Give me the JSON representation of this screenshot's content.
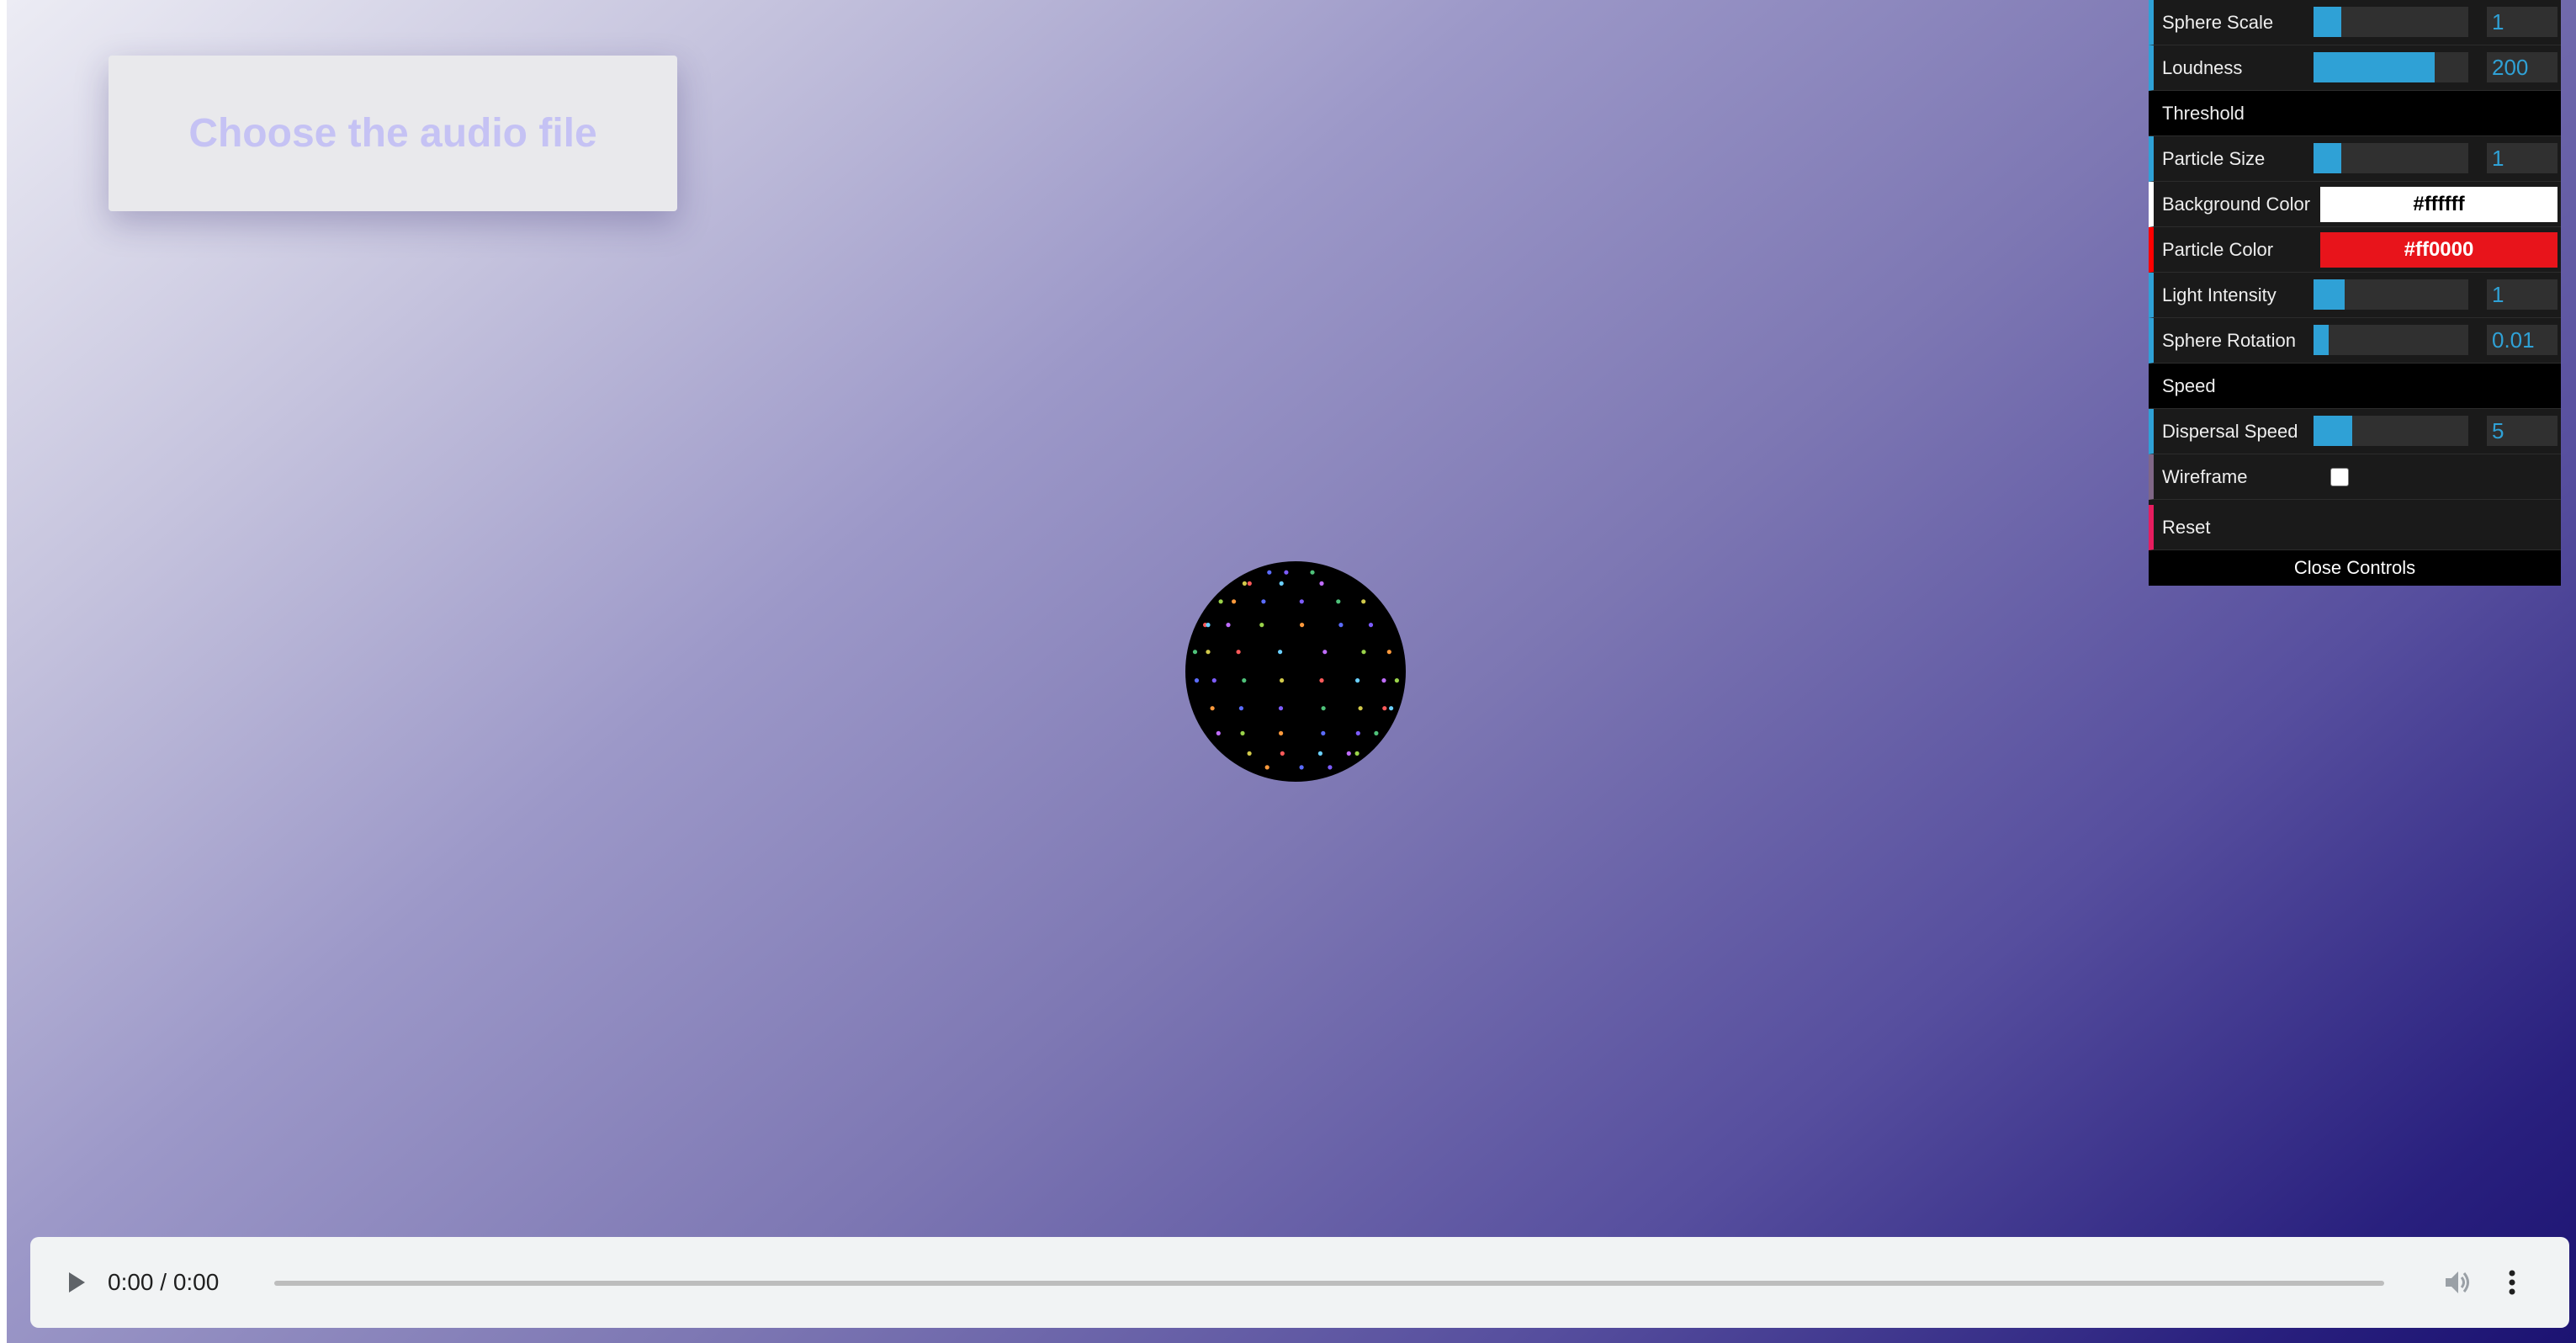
{
  "upload": {
    "label": "Choose the audio file"
  },
  "controls": {
    "rows_top": [
      {
        "label": "Sphere Scale",
        "value": "1",
        "fill": 0.18
      },
      {
        "label": "Loudness",
        "value": "200",
        "fill": 0.78
      }
    ],
    "folder_threshold": "Threshold",
    "particle_size": {
      "label": "Particle Size",
      "value": "1",
      "fill": 0.18
    },
    "background_color": {
      "label": "Background Color",
      "value": "#ffffff",
      "swatch": "#ffffff",
      "text_color": "#000000"
    },
    "particle_color": {
      "label": "Particle Color",
      "value": "#ff0000",
      "swatch": "#e8141b",
      "text_color": "#ffffff"
    },
    "light_intensity": {
      "label": "Light Intensity",
      "value": "1",
      "fill": 0.2
    },
    "sphere_rotation": {
      "label": "Sphere Rotation",
      "value": "0.01",
      "fill": 0.1
    },
    "folder_speed": "Speed",
    "dispersal_speed": {
      "label": "Dispersal Speed",
      "value": "5",
      "fill": 0.25
    },
    "wireframe": {
      "label": "Wireframe",
      "checked": false
    },
    "reset": {
      "label": "Reset"
    },
    "close": {
      "label": "Close Controls"
    }
  },
  "audio": {
    "time": "0:00 / 0:00"
  },
  "colors": {
    "accent": "#2fa1d6",
    "panel_bg": "#1a1a1a",
    "gradient_start": "#ececf4",
    "gradient_end": "#1c1372"
  },
  "icons": [
    "play-icon",
    "volume-icon",
    "more-vert-icon"
  ]
}
